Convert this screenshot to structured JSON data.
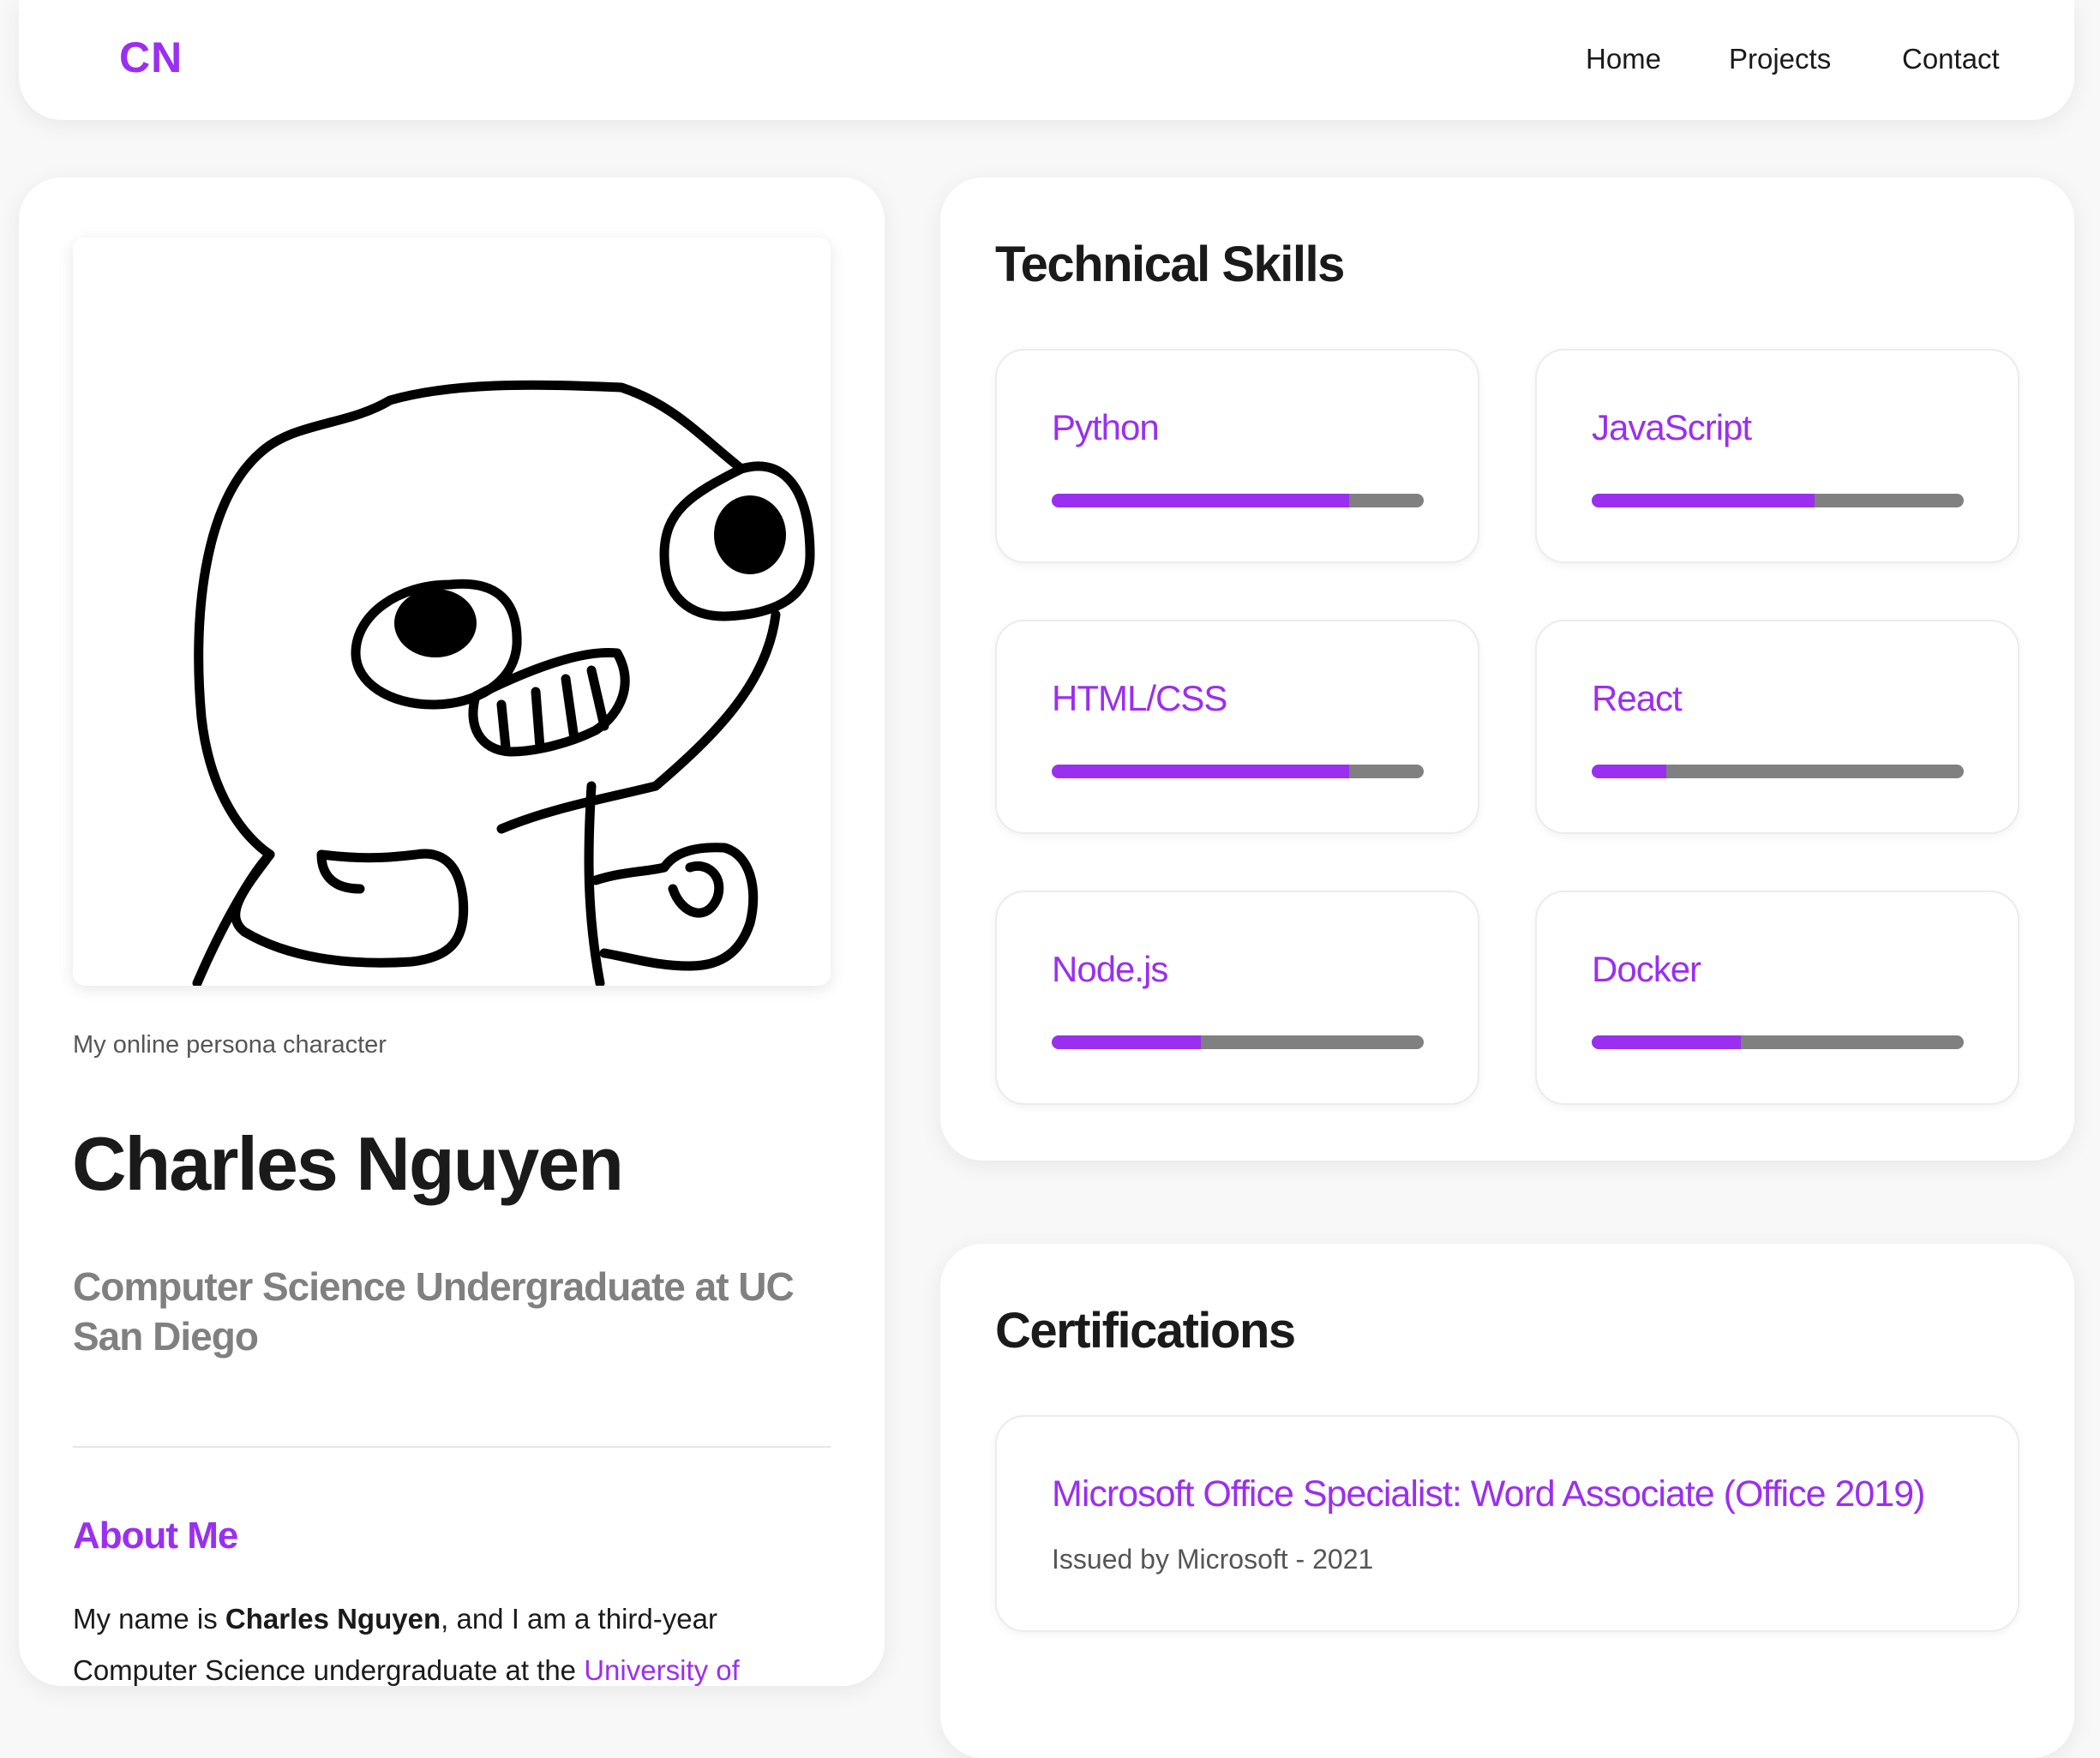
{
  "header": {
    "logo": "CN",
    "nav": {
      "home": "Home",
      "projects": "Projects",
      "contact": "Contact"
    }
  },
  "profile": {
    "image_caption": "My online persona character",
    "name": "Charles Nguyen",
    "subtitle": "Computer Science Undergraduate at UC San Diego",
    "about_title": "About Me",
    "about_prefix": "My name is ",
    "about_name": "Charles Nguyen",
    "about_middle": ", and I am a third-year",
    "about_line2": "Computer Science undergraduate at the ",
    "about_link": "University of"
  },
  "skills": {
    "title": "Technical Skills",
    "items": [
      {
        "name": "Python",
        "level": 0.8
      },
      {
        "name": "JavaScript",
        "level": 0.6
      },
      {
        "name": "HTML/CSS",
        "level": 0.8
      },
      {
        "name": "React",
        "level": 0.2
      },
      {
        "name": "Node.js",
        "level": 0.4
      },
      {
        "name": "Docker",
        "level": 0.4
      }
    ]
  },
  "certifications": {
    "title": "Certifications",
    "items": [
      {
        "name": "Microsoft Office Specialist: Word Associate (Office 2019)",
        "issuer": "Issued by Microsoft - 2021"
      }
    ]
  },
  "colors": {
    "accent": "#9a2ff0",
    "bar_track": "#808080",
    "page_bg": "#f8f8f8",
    "subtitle": "#808080"
  }
}
